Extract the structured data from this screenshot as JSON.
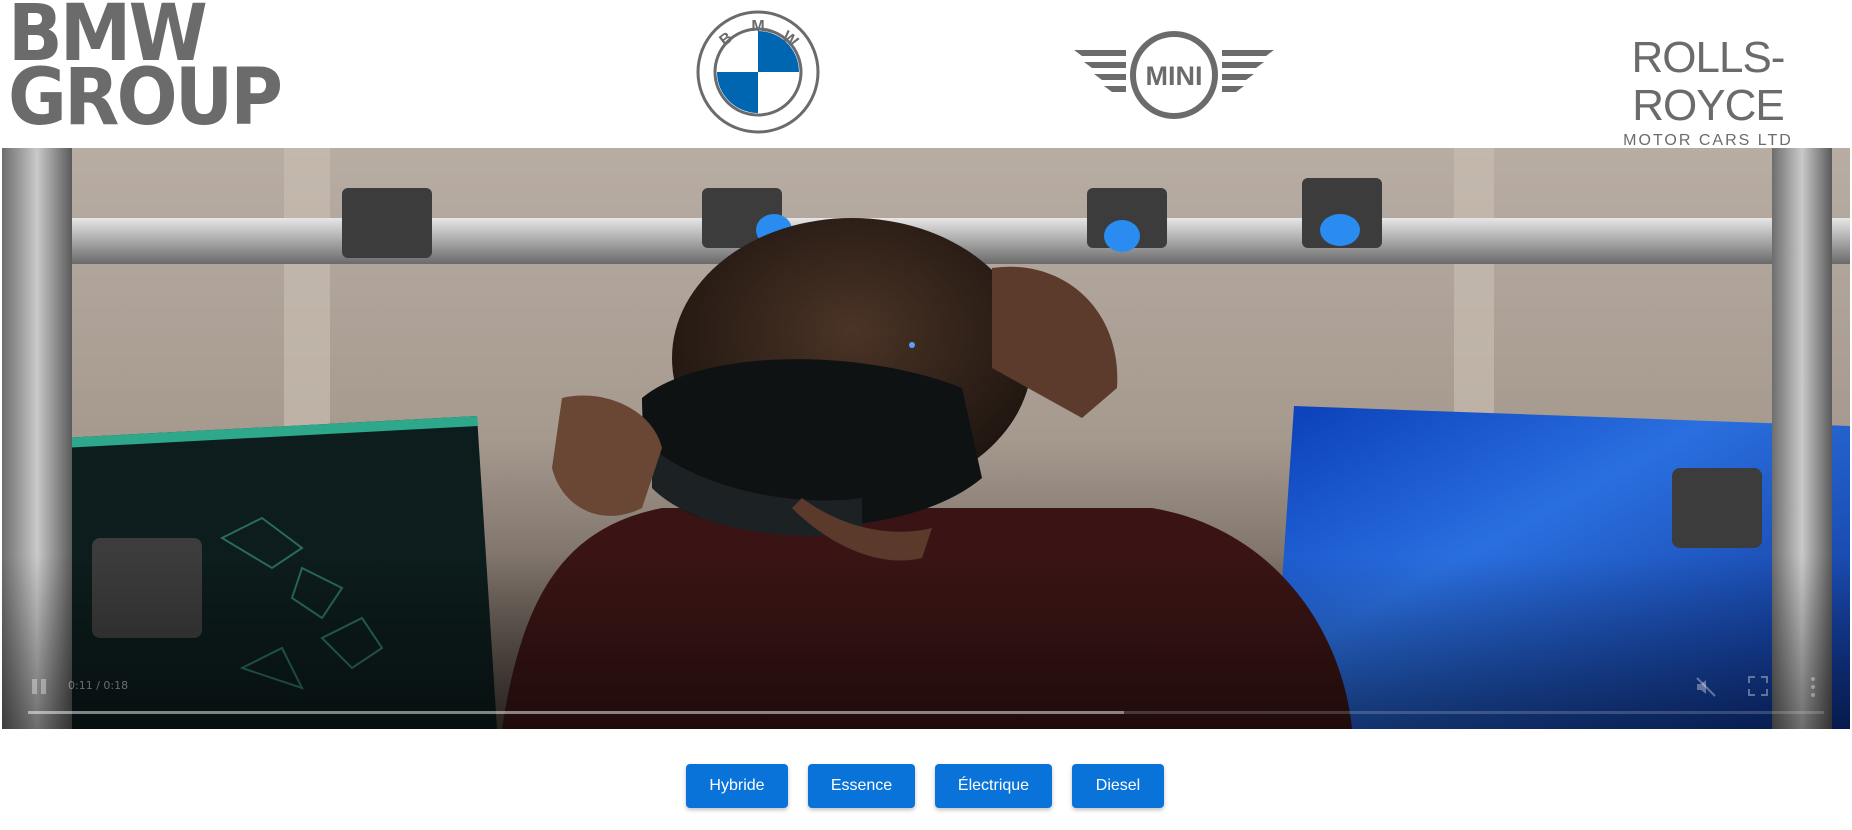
{
  "header": {
    "bmw_group": {
      "line1": "BMW",
      "line2": "GROUP"
    },
    "bmw_logo": {
      "letters": [
        "B",
        "M",
        "W"
      ]
    },
    "mini_logo": {
      "text": "MINI"
    },
    "rolls_royce": {
      "title": "ROLLS-ROYCE",
      "subtitle": "MOTOR CARS LTD"
    }
  },
  "video": {
    "time": "0:11 / 0:18",
    "progress": 0.61,
    "state": "playing",
    "muted": true
  },
  "buttons": [
    {
      "label": "Hybride"
    },
    {
      "label": "Essence"
    },
    {
      "label": "Électrique"
    },
    {
      "label": "Diesel"
    }
  ],
  "colors": {
    "logo_gray": "#6b6b6c",
    "bmw_blue": "#0066b1",
    "button_blue": "#0a73d9"
  }
}
